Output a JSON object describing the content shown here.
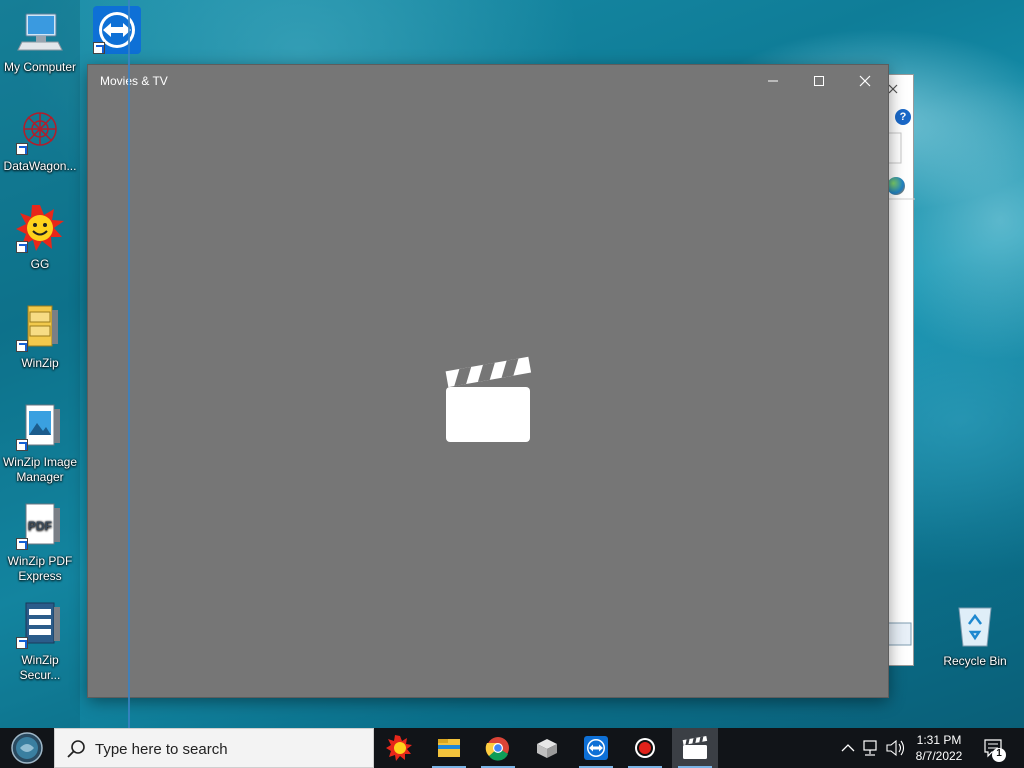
{
  "desktop": {
    "icons": [
      {
        "label": "My Computer",
        "icon": "computer-icon"
      },
      {
        "label": "DataWagon...",
        "icon": "datawagon-icon"
      },
      {
        "label": "GG",
        "icon": "sun-face-icon"
      },
      {
        "label": "WinZip",
        "icon": "winzip-icon"
      },
      {
        "label": "WinZip Image Manager",
        "icon": "winzip-image-icon"
      },
      {
        "label": "WinZip PDF Express",
        "icon": "winzip-pdf-icon"
      },
      {
        "label": "WinZip Secur...",
        "icon": "winzip-secure-icon"
      },
      {
        "label": "TeamViewer",
        "icon": "teamviewer-icon"
      },
      {
        "label": "Recycle Bin",
        "icon": "recycle-bin-icon"
      }
    ]
  },
  "movies_window": {
    "title": "Movies & TV",
    "minimize_icon": "minimize-icon",
    "maximize_icon": "maximize-icon",
    "close_icon": "close-icon",
    "center_icon": "clapperboard-icon"
  },
  "background_window": {
    "help_icon": "help-icon",
    "globe_icon": "globe-icon"
  },
  "taskbar": {
    "start_icon": "start-orb-icon",
    "search_placeholder": "Type here to search",
    "search_icon": "search-icon",
    "apps": [
      {
        "name": "GG",
        "icon": "sun-face-icon"
      },
      {
        "name": "File Explorer",
        "icon": "folder-icon"
      },
      {
        "name": "Google Chrome",
        "icon": "chrome-icon"
      },
      {
        "name": "App",
        "icon": "package-icon"
      },
      {
        "name": "TeamViewer",
        "icon": "teamviewer-icon"
      },
      {
        "name": "Recorder",
        "icon": "record-icon"
      },
      {
        "name": "Movies & TV",
        "icon": "clapperboard-icon"
      }
    ],
    "tray": {
      "chevron_icon": "chevron-up-icon",
      "network_icon": "network-icon",
      "volume_icon": "volume-icon",
      "time": "1:31 PM",
      "date": "8/7/2022",
      "notification_count": "1",
      "notification_icon": "notification-icon"
    }
  },
  "colors": {
    "window_bg": "#767676",
    "taskbar_bg": "#111418",
    "accent": "#3a82c4"
  }
}
